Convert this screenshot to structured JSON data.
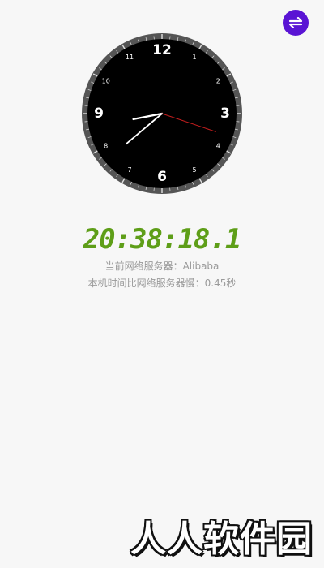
{
  "toolbar": {
    "switch_icon": "swap-horizontal-icon",
    "switch_color": "#5a14d4"
  },
  "clock": {
    "numerals": [
      "12",
      "1",
      "2",
      "3",
      "4",
      "5",
      "6",
      "7",
      "8",
      "9",
      "10",
      "11"
    ],
    "hour": 20,
    "minute": 38,
    "second": 18.1,
    "face_color": "#000000",
    "bezel_color": "#555555",
    "hand_color": "#ffffff",
    "second_hand_color": "#c81e1e"
  },
  "time_display": {
    "text": "20:38:18.1",
    "color": "#5e9e18"
  },
  "server_info": {
    "line": "当前网络服务器：Alibaba"
  },
  "offset_info": {
    "line": "本机时间比网络服务器慢：0.45秒"
  },
  "watermark": {
    "text": "人人软件园"
  }
}
